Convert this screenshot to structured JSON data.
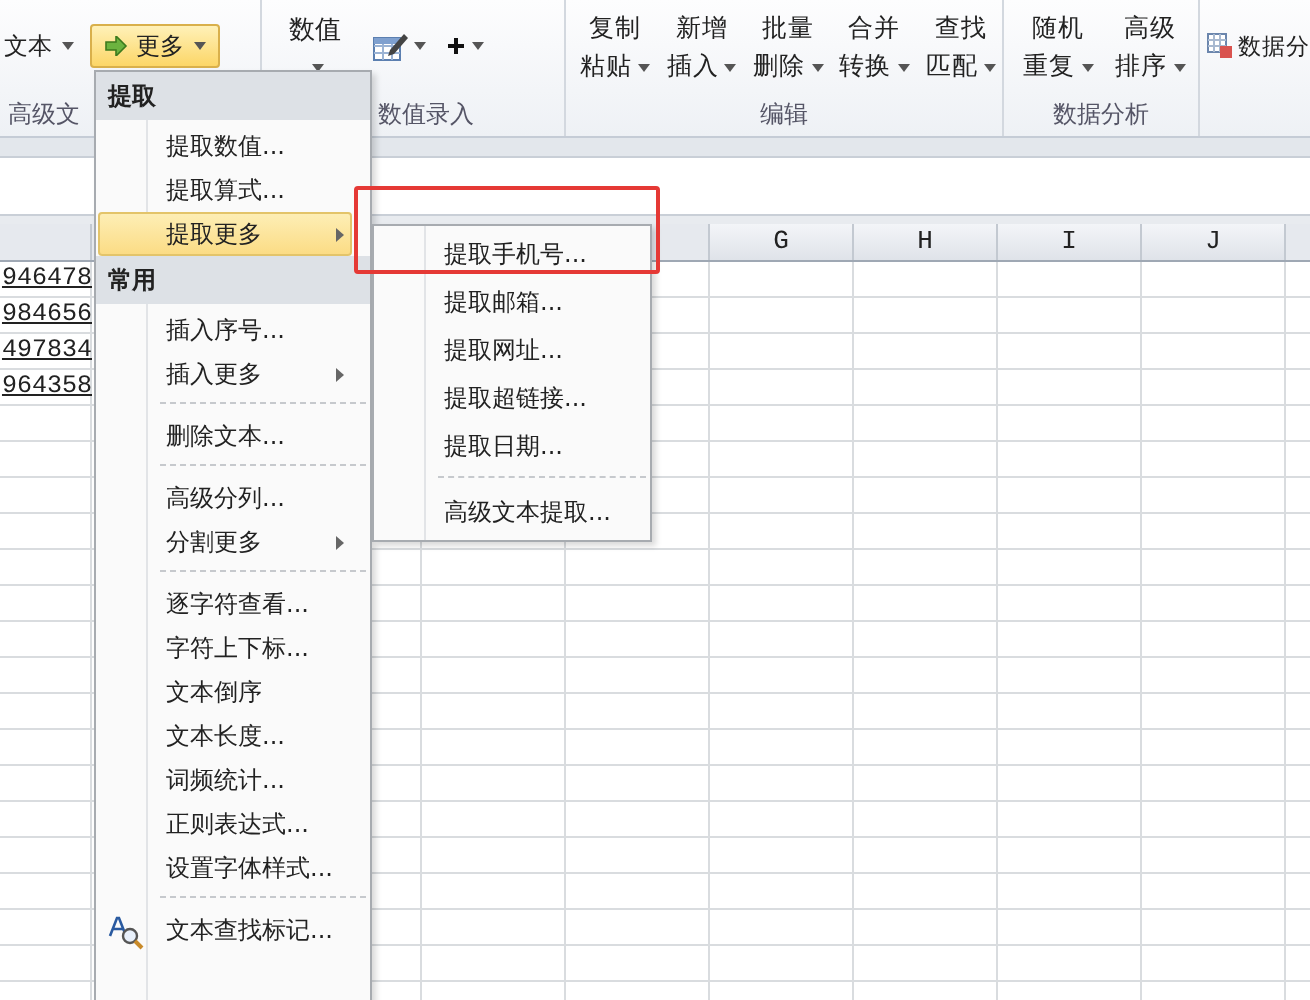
{
  "ribbon": {
    "text_buttons": [
      {
        "label": "文本"
      }
    ],
    "more_button": {
      "label": "更多",
      "pressed": true
    },
    "number_button": {
      "label": "数值"
    },
    "edit_buttons": [
      {
        "top": "复制",
        "bottom": "粘贴"
      },
      {
        "top": "新增",
        "bottom": "插入"
      },
      {
        "top": "批量",
        "bottom": "删除"
      },
      {
        "top": "合并",
        "bottom": "转换"
      },
      {
        "top": "查找",
        "bottom": "匹配"
      }
    ],
    "analysis_buttons": [
      {
        "top": "随机",
        "bottom": "重复"
      },
      {
        "top": "高级",
        "bottom": "排序"
      }
    ],
    "side_buttons": [
      {
        "label": "数据分"
      }
    ],
    "group_labels": [
      "高级文",
      "数值录入",
      "编辑",
      "数据分析"
    ]
  },
  "sheet": {
    "column_headers": [
      "G",
      "H",
      "I",
      "J"
    ],
    "cells": [
      "946478",
      "984656",
      "497834",
      "964358"
    ]
  },
  "menu": {
    "items": [
      {
        "kind": "header",
        "label": "提取"
      },
      {
        "kind": "item",
        "label": "提取数值...",
        "selected": false,
        "has_submenu": false,
        "icon": false
      },
      {
        "kind": "item",
        "label": "提取算式...",
        "selected": false,
        "has_submenu": false,
        "icon": false
      },
      {
        "kind": "item",
        "label": "提取更多",
        "selected": true,
        "has_submenu": true,
        "icon": false
      },
      {
        "kind": "header",
        "label": "常用"
      },
      {
        "kind": "item",
        "label": "插入序号...",
        "selected": false,
        "has_submenu": false,
        "icon": false
      },
      {
        "kind": "item",
        "label": "插入更多",
        "selected": false,
        "has_submenu": true,
        "icon": false
      },
      {
        "kind": "separator"
      },
      {
        "kind": "item",
        "label": "删除文本...",
        "selected": false,
        "has_submenu": false,
        "icon": false
      },
      {
        "kind": "separator"
      },
      {
        "kind": "item",
        "label": "高级分列...",
        "selected": false,
        "has_submenu": false,
        "icon": false
      },
      {
        "kind": "item",
        "label": "分割更多",
        "selected": false,
        "has_submenu": true,
        "icon": false
      },
      {
        "kind": "separator"
      },
      {
        "kind": "item",
        "label": "逐字符查看...",
        "selected": false,
        "has_submenu": false,
        "icon": false
      },
      {
        "kind": "item",
        "label": "字符上下标...",
        "selected": false,
        "has_submenu": false,
        "icon": false
      },
      {
        "kind": "item",
        "label": "文本倒序",
        "selected": false,
        "has_submenu": false,
        "icon": false
      },
      {
        "kind": "item",
        "label": "文本长度...",
        "selected": false,
        "has_submenu": false,
        "icon": false
      },
      {
        "kind": "item",
        "label": "词频统计...",
        "selected": false,
        "has_submenu": false,
        "icon": false
      },
      {
        "kind": "item",
        "label": "正则表达式...",
        "selected": false,
        "has_submenu": false,
        "icon": false
      },
      {
        "kind": "item",
        "label": "设置字体样式...",
        "selected": false,
        "has_submenu": false,
        "icon": false
      },
      {
        "kind": "separator"
      },
      {
        "kind": "item",
        "label": "文本查找标记...",
        "selected": false,
        "has_submenu": false,
        "icon": true
      }
    ]
  },
  "submenu": {
    "items": [
      {
        "kind": "item",
        "label": "提取手机号...",
        "selected": false,
        "highlighted": true
      },
      {
        "kind": "item",
        "label": "提取邮箱...",
        "selected": false,
        "highlighted": false
      },
      {
        "kind": "item",
        "label": "提取网址...",
        "selected": false,
        "highlighted": false
      },
      {
        "kind": "item",
        "label": "提取超链接...",
        "selected": false,
        "highlighted": false
      },
      {
        "kind": "item",
        "label": "提取日期...",
        "selected": false,
        "highlighted": false
      },
      {
        "kind": "separator"
      },
      {
        "kind": "item",
        "label": "高级文本提取...",
        "selected": false,
        "highlighted": false
      }
    ]
  }
}
